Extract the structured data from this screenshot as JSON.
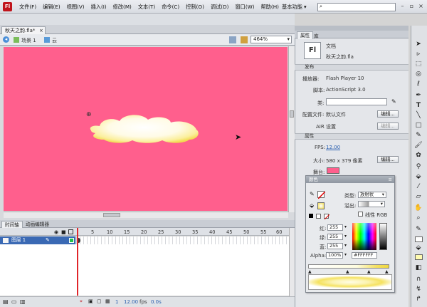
{
  "app": {
    "logo": "Fl"
  },
  "menu": [
    "文件(F)",
    "编辑(E)",
    "视图(V)",
    "插入(I)",
    "修改(M)",
    "文本(T)",
    "命令(C)",
    "控制(O)",
    "调试(D)",
    "窗口(W)",
    "帮助(H)"
  ],
  "workspace": "基本功能",
  "search_placeholder": "",
  "document_tab": {
    "label": "秋天之韵.fla*",
    "close": "×"
  },
  "edit_bar": {
    "scene": "场景 1",
    "symbol": "云",
    "zoom": "464%"
  },
  "timeline": {
    "tabs": [
      "时间轴",
      "动画编辑器"
    ],
    "frame_numbers": [
      "5",
      "10",
      "15",
      "20",
      "25",
      "30",
      "35",
      "40",
      "45",
      "50",
      "55",
      "60"
    ],
    "layer_name": "图层 1",
    "footer": {
      "current_frame": "1",
      "fps": "12.00",
      "fps_unit": "fps",
      "time": "0.0s"
    }
  },
  "properties": {
    "tabs": [
      "属性",
      "库"
    ],
    "doc_label": "文档",
    "doc_name": "秋天之韵.fla",
    "publish_section": "发布",
    "player_label": "播放器:",
    "player_value": "Flash Player 10",
    "script_label": "脚本:",
    "script_value": "ActionScript 3.0",
    "class_label": "类:",
    "profile_label": "配置文件:",
    "profile_value": "默认文件",
    "edit_btn": "编辑...",
    "air_label": "AIR 设置",
    "air_btn": "编辑...",
    "props_section": "属性",
    "fps_label": "FPS:",
    "fps_value": "12.00",
    "size_label": "大小:",
    "size_value": "580 x 379 像素",
    "size_btn": "编辑...",
    "stage_label": "舞台:",
    "stage_color": "#ff5f8d"
  },
  "color_panel": {
    "title": "颜色",
    "type_label": "类型:",
    "type_value": "放射状",
    "overflow_label": "溢出:",
    "linear_rgb_label": "线性 RGB",
    "red_label": "红:",
    "red": "255",
    "green_label": "绿:",
    "green": "255",
    "blue_label": "蓝:",
    "blue": "255",
    "alpha_label": "Alpha:",
    "alpha": "100%",
    "hex": "#FFFFFF"
  },
  "colors": {
    "stage": "#ff5f8d",
    "layer_selected": "#3a69b4",
    "playhead": "#e0252a",
    "cloud": "#fffbe0"
  }
}
